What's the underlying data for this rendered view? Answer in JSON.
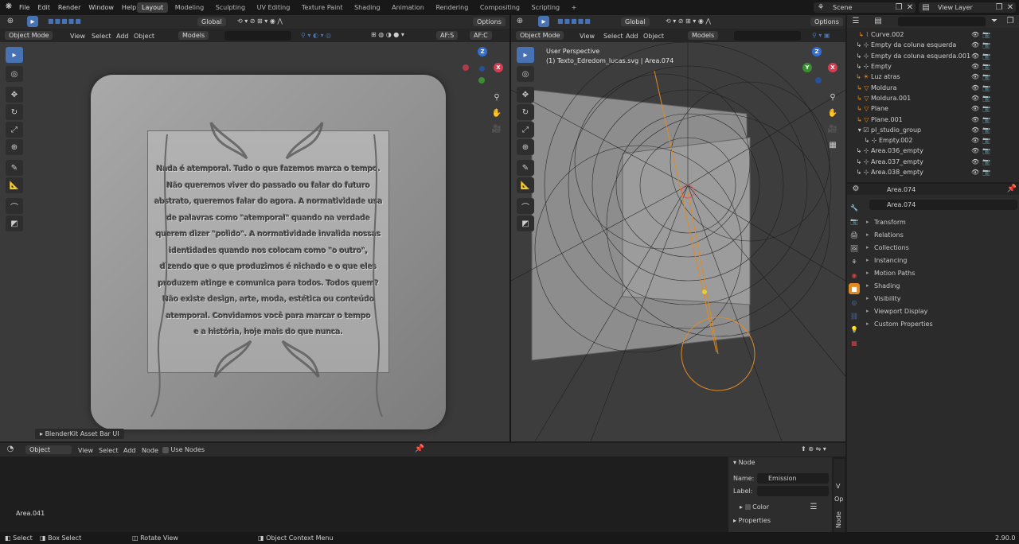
{
  "topbar": {
    "menus": [
      "File",
      "Edit",
      "Render",
      "Window",
      "Help"
    ],
    "workspaces": [
      "Layout",
      "Modeling",
      "Sculpting",
      "UV Editing",
      "Texture Paint",
      "Shading",
      "Animation",
      "Rendering",
      "Compositing",
      "Scripting"
    ],
    "active_workspace": "Layout",
    "add_tab": "+",
    "scene": "Scene",
    "view_layer": "View Layer"
  },
  "left_viewport": {
    "orientation": "Global",
    "options": "Options",
    "mode": "Object Mode",
    "menus": [
      "View",
      "Select",
      "Add",
      "Object"
    ],
    "models": "Models",
    "af_s": "AF:S",
    "af_c": "AF:C",
    "poem_lines": [
      "Nada é atemporal. Tudo o que fazemos marca o tempo.",
      "Não queremos viver do passado ou falar do futuro",
      "abstrato, queremos falar do agora. A normatividade usa",
      "de palavras como \"atemporal\" quando na verdade",
      "querem dizer \"polido\". A normatividade invalida nossas",
      "identidades quando nos colocam como \"o outro\",",
      "dizendo que o que produzimos é nichado e o que eles",
      "produzem atinge e comunica para todos. Todos quem?",
      "Não existe design, arte, moda, estética ou conteúdo",
      "atemporal. Convidamos você para marcar o tempo",
      "e a história, hoje mais do que nunca."
    ],
    "asset_bar": "BlenderKit Asset Bar UI"
  },
  "right_viewport": {
    "orientation": "Global",
    "options": "Options",
    "mode": "Object Mode",
    "menus": [
      "View",
      "Select",
      "Add",
      "Object"
    ],
    "models": "Models",
    "perspective": "User Perspective",
    "active_info": "(1) Texto_Edredom_lucas.svg | Area.074"
  },
  "outliner": {
    "rows": [
      {
        "name": "Curve.002",
        "type": "curve"
      },
      {
        "name": "Empty da coluna esquerda",
        "type": "empty"
      },
      {
        "name": "Empty da coluna esquerda.001",
        "type": "empty"
      },
      {
        "name": "Empty",
        "type": "empty"
      },
      {
        "name": "Luz atras",
        "type": "light"
      },
      {
        "name": "Moldura",
        "type": "mesh"
      },
      {
        "name": "Moldura.001",
        "type": "mesh"
      },
      {
        "name": "Plane",
        "type": "mesh"
      },
      {
        "name": "Plane.001",
        "type": "mesh"
      },
      {
        "name": "pl_studio_group",
        "type": "collection"
      },
      {
        "name": "Empty.002",
        "type": "empty"
      },
      {
        "name": "Area.036_empty",
        "type": "empty"
      },
      {
        "name": "Area.037_empty",
        "type": "empty"
      },
      {
        "name": "Area.038_empty",
        "type": "empty"
      }
    ]
  },
  "properties": {
    "object_name": "Area.074",
    "panels": [
      "Transform",
      "Relations",
      "Collections",
      "Instancing",
      "Motion Paths",
      "Shading",
      "Visibility",
      "Viewport Display",
      "Custom Properties"
    ]
  },
  "node_editor": {
    "type": "Object",
    "menus": [
      "View",
      "Select",
      "Add",
      "Node"
    ],
    "use_nodes": "Use Nodes",
    "object_label": "Area.041",
    "panel_title": "Node",
    "name_label": "Name:",
    "name_value": "Emission",
    "label_label": "Label:",
    "color": "Color",
    "properties": "Properties",
    "side_tabs": [
      "Node",
      "Op",
      "V"
    ]
  },
  "statusbar": {
    "select": "Select",
    "box_select": "Box Select",
    "rotate": "Rotate View",
    "context_menu": "Object Context Menu",
    "version": "2.90.0"
  },
  "colors": {
    "accent": "#4772b3",
    "active_object": "#e08a24",
    "header": "#2b2b2b",
    "viewport": "#3d3d3d"
  }
}
